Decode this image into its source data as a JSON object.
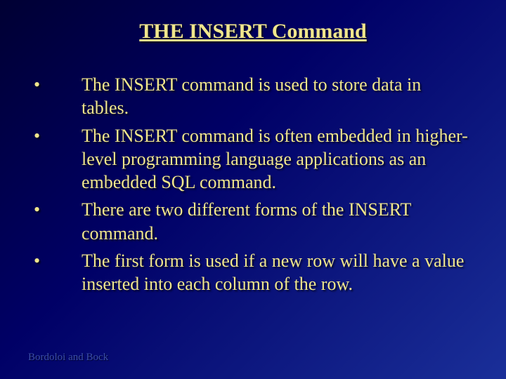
{
  "title": "THE INSERT Command",
  "bullets": [
    "The INSERT command is used to store data in tables.",
    "The INSERT command is often embedded in higher-level programming language applications as an embedded SQL command.",
    "There are two different forms of the INSERT command.",
    "The first form is used if a new row will have a value inserted into each column of the row."
  ],
  "bullet_char": "•",
  "footer": "Bordoloi and Bock"
}
